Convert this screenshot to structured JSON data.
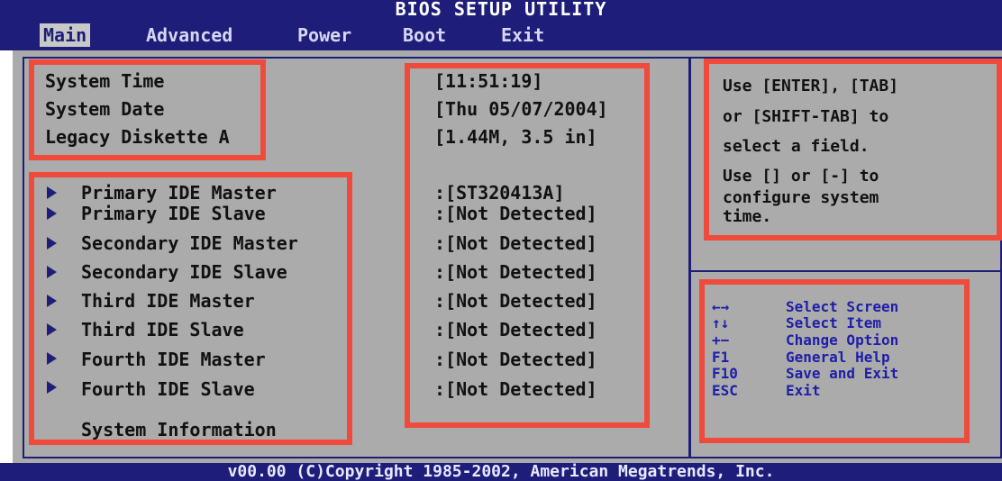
{
  "title": "BIOS SETUP UTILITY",
  "menu": [
    {
      "label": "Main",
      "active": true
    },
    {
      "label": "Advanced",
      "active": false
    },
    {
      "label": "Power",
      "active": false
    },
    {
      "label": "Boot",
      "active": false
    },
    {
      "label": "Exit",
      "active": false
    }
  ],
  "settings": [
    {
      "label": "System Time",
      "value": "[11:51:19]"
    },
    {
      "label": "System Date",
      "value": "[Thu 05/07/2004]"
    },
    {
      "label": "Legacy Diskette A",
      "value": "[1.44M, 3.5 in]"
    }
  ],
  "devices": [
    {
      "label": "Primary IDE Master",
      "value": ":[ST320413A]"
    },
    {
      "label": "Primary IDE Slave",
      "value": ":[Not Detected]"
    },
    {
      "label": "Secondary IDE Master",
      "value": ":[Not Detected]"
    },
    {
      "label": "Secondary IDE Slave",
      "value": ":[Not Detected]"
    },
    {
      "label": "Third IDE Master",
      "value": ":[Not Detected]"
    },
    {
      "label": "Third IDE Slave",
      "value": ":[Not Detected]"
    },
    {
      "label": "Fourth IDE Master",
      "value": ":[Not Detected]"
    },
    {
      "label": "Fourth IDE Slave",
      "value": ":[Not Detected]"
    }
  ],
  "system_information": "System Information",
  "help": {
    "lines": [
      "Use [ENTER], [TAB]",
      "or [SHIFT-TAB] to",
      "select a field.",
      "Use [] or [-] to",
      "configure system",
      "time."
    ]
  },
  "keys": [
    {
      "key": "←→",
      "action": "Select Screen"
    },
    {
      "key": "↑↓",
      "action": "Select Item"
    },
    {
      "key": "+−",
      "action": "Change Option"
    },
    {
      "key": "F1",
      "action": "General Help"
    },
    {
      "key": "F10",
      "action": "Save and Exit"
    },
    {
      "key": "ESC",
      "action": "Exit"
    }
  ],
  "footer": "v00.00 (C)Copyright 1985-2002, American Megatrends, Inc.",
  "colors": {
    "bios_blue": "#1e1e7a",
    "panel_gray": "#ababab",
    "highlight_red": "#ef4a3b",
    "key_blue": "#1e1ea8"
  }
}
